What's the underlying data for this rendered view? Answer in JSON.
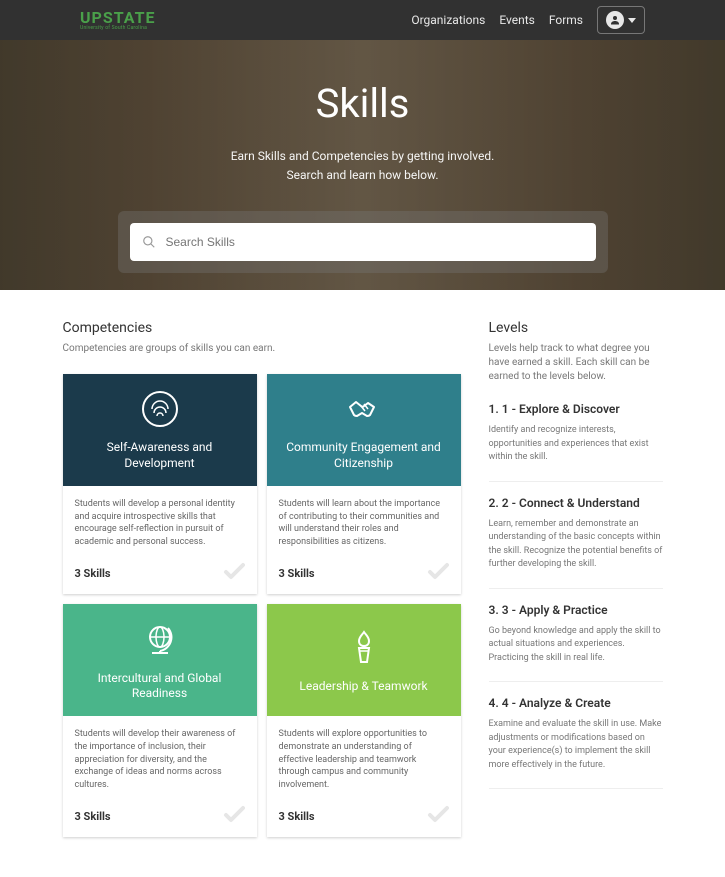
{
  "nav": {
    "logo_main": "UPSTATE",
    "logo_sub": "University of South Carolina",
    "links": [
      {
        "label": "Organizations"
      },
      {
        "label": "Events"
      },
      {
        "label": "Forms"
      }
    ]
  },
  "hero": {
    "title": "Skills",
    "sub_line1": "Earn Skills and Competencies by getting involved.",
    "sub_line2": "Search and learn how below.",
    "search_placeholder": "Search Skills"
  },
  "competencies": {
    "heading": "Competencies",
    "sub": "Competencies are groups of skills you can earn.",
    "cards": [
      {
        "title": "Self-Awareness and Development",
        "desc": "Students will develop a personal identity and acquire introspective skills that encourage self-reflection in pursuit of academic and personal success.",
        "skills": "3 Skills",
        "icon": "fingerprint-icon",
        "bg": "bg-navy"
      },
      {
        "title": "Community Engagement and Citizenship",
        "desc": "Students will learn about the importance of contributing to their communities and will understand their roles and responsibilities as citizens.",
        "skills": "3 Skills",
        "icon": "handshake-icon",
        "bg": "bg-teal"
      },
      {
        "title": "Intercultural and Global Readiness",
        "desc": "Students will develop their awareness of the importance of inclusion, their appreciation for diversity, and the exchange of ideas and norms across cultures.",
        "skills": "3 Skills",
        "icon": "globe-icon",
        "bg": "bg-green"
      },
      {
        "title": "Leadership & Teamwork",
        "desc": "Students will explore opportunities to demonstrate an understanding of effective leadership and teamwork through campus and community involvement.",
        "skills": "3 Skills",
        "icon": "torch-icon",
        "bg": "bg-lime"
      }
    ]
  },
  "levels": {
    "heading": "Levels",
    "sub": "Levels help track to what degree you have earned a skill. Each skill can be earned to the levels below.",
    "items": [
      {
        "title": "1. 1 - Explore & Discover",
        "desc": "Identify and recognize interests, opportunities and experiences that exist within the skill."
      },
      {
        "title": "2. 2 - Connect & Understand",
        "desc": "Learn, remember and demonstrate an understanding of the basic concepts within the skill. Recognize the potential benefits of further developing the skill."
      },
      {
        "title": "3. 3 - Apply & Practice",
        "desc": "Go beyond knowledge and apply the skill to actual situations and experiences. Practicing the skill in real life."
      },
      {
        "title": "4. 4 - Analyze & Create",
        "desc": "Examine and evaluate the skill in use. Make adjustments or modifications based on your experience(s) to implement the skill more effectively in the future."
      }
    ]
  }
}
